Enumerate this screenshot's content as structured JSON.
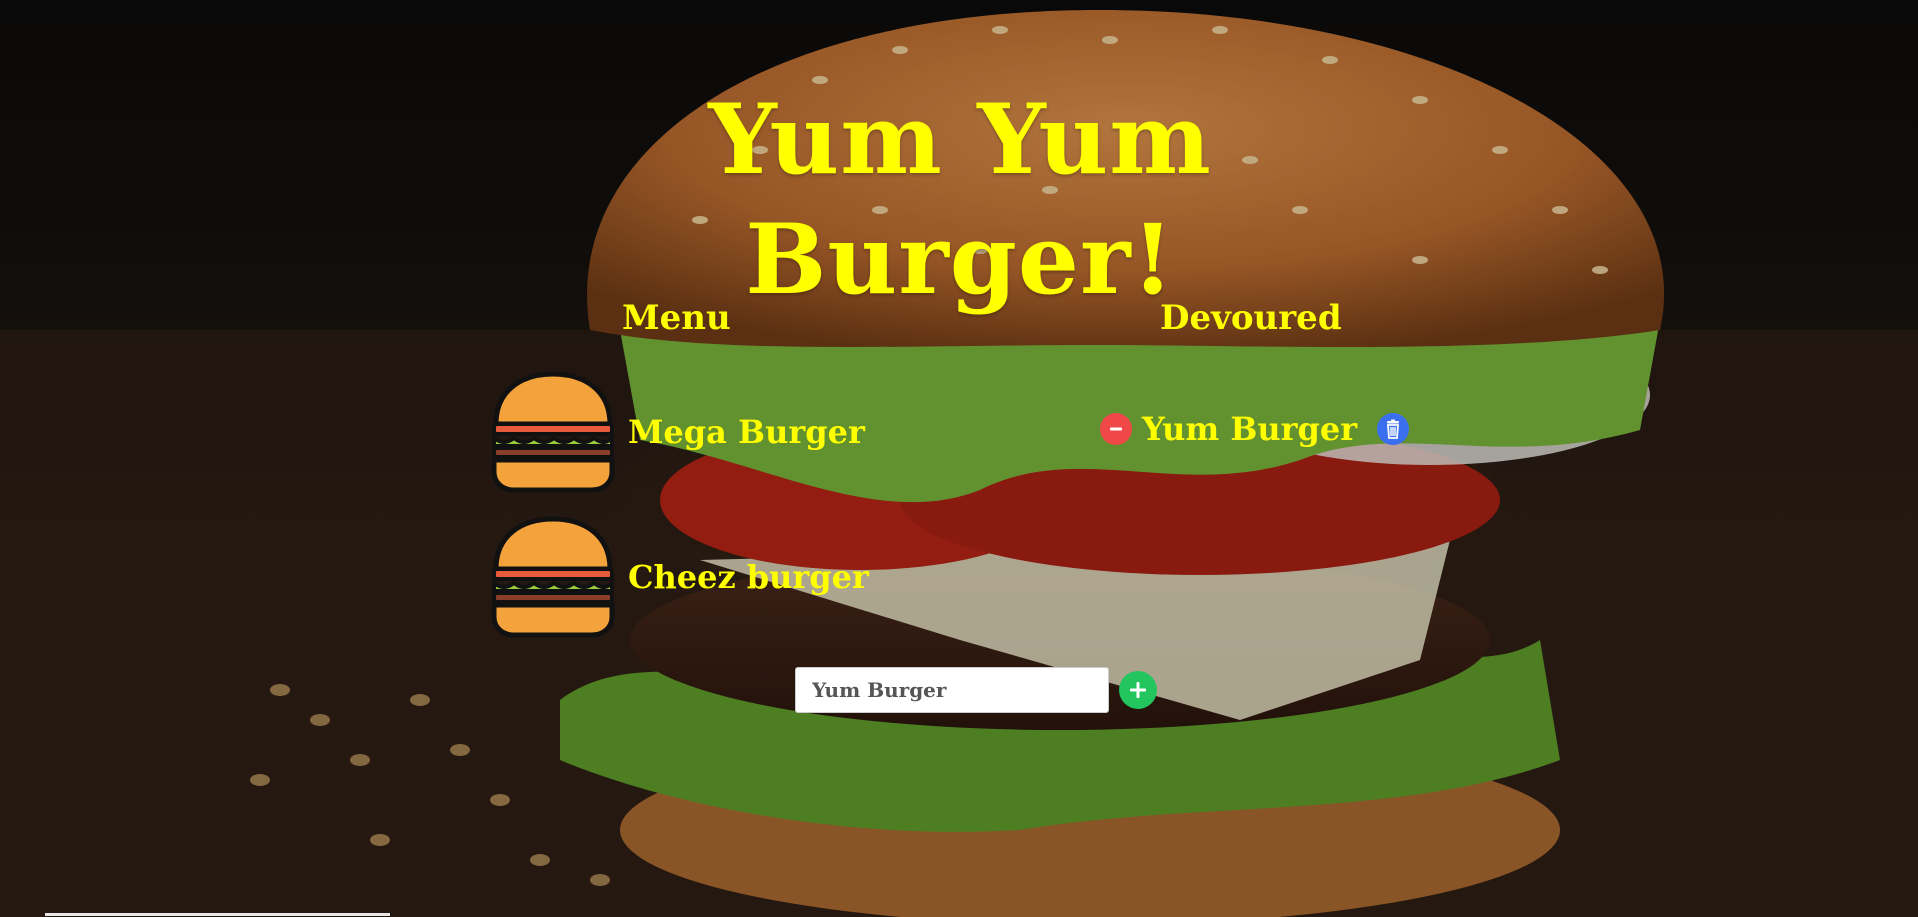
{
  "page": {
    "title": "Yum Yum Burger!",
    "accent_color": "#ffff00",
    "background_image": "burger-photo"
  },
  "menu": {
    "heading": "Menu",
    "items": [
      {
        "name": "Mega Burger",
        "icon": "burger-icon"
      },
      {
        "name": "Cheez burger",
        "icon": "burger-icon"
      }
    ]
  },
  "devoured": {
    "heading": "Devoured",
    "items": [
      {
        "name": "Yum Burger",
        "remove_icon": "minus-circle-icon",
        "delete_icon": "trash-icon"
      }
    ]
  },
  "form": {
    "input_placeholder": "Yum Burger",
    "input_value": "",
    "add_icon": "plus-circle-icon"
  },
  "colors": {
    "remove": "#f04848",
    "delete": "#3a6ff0",
    "add": "#22c55e"
  }
}
